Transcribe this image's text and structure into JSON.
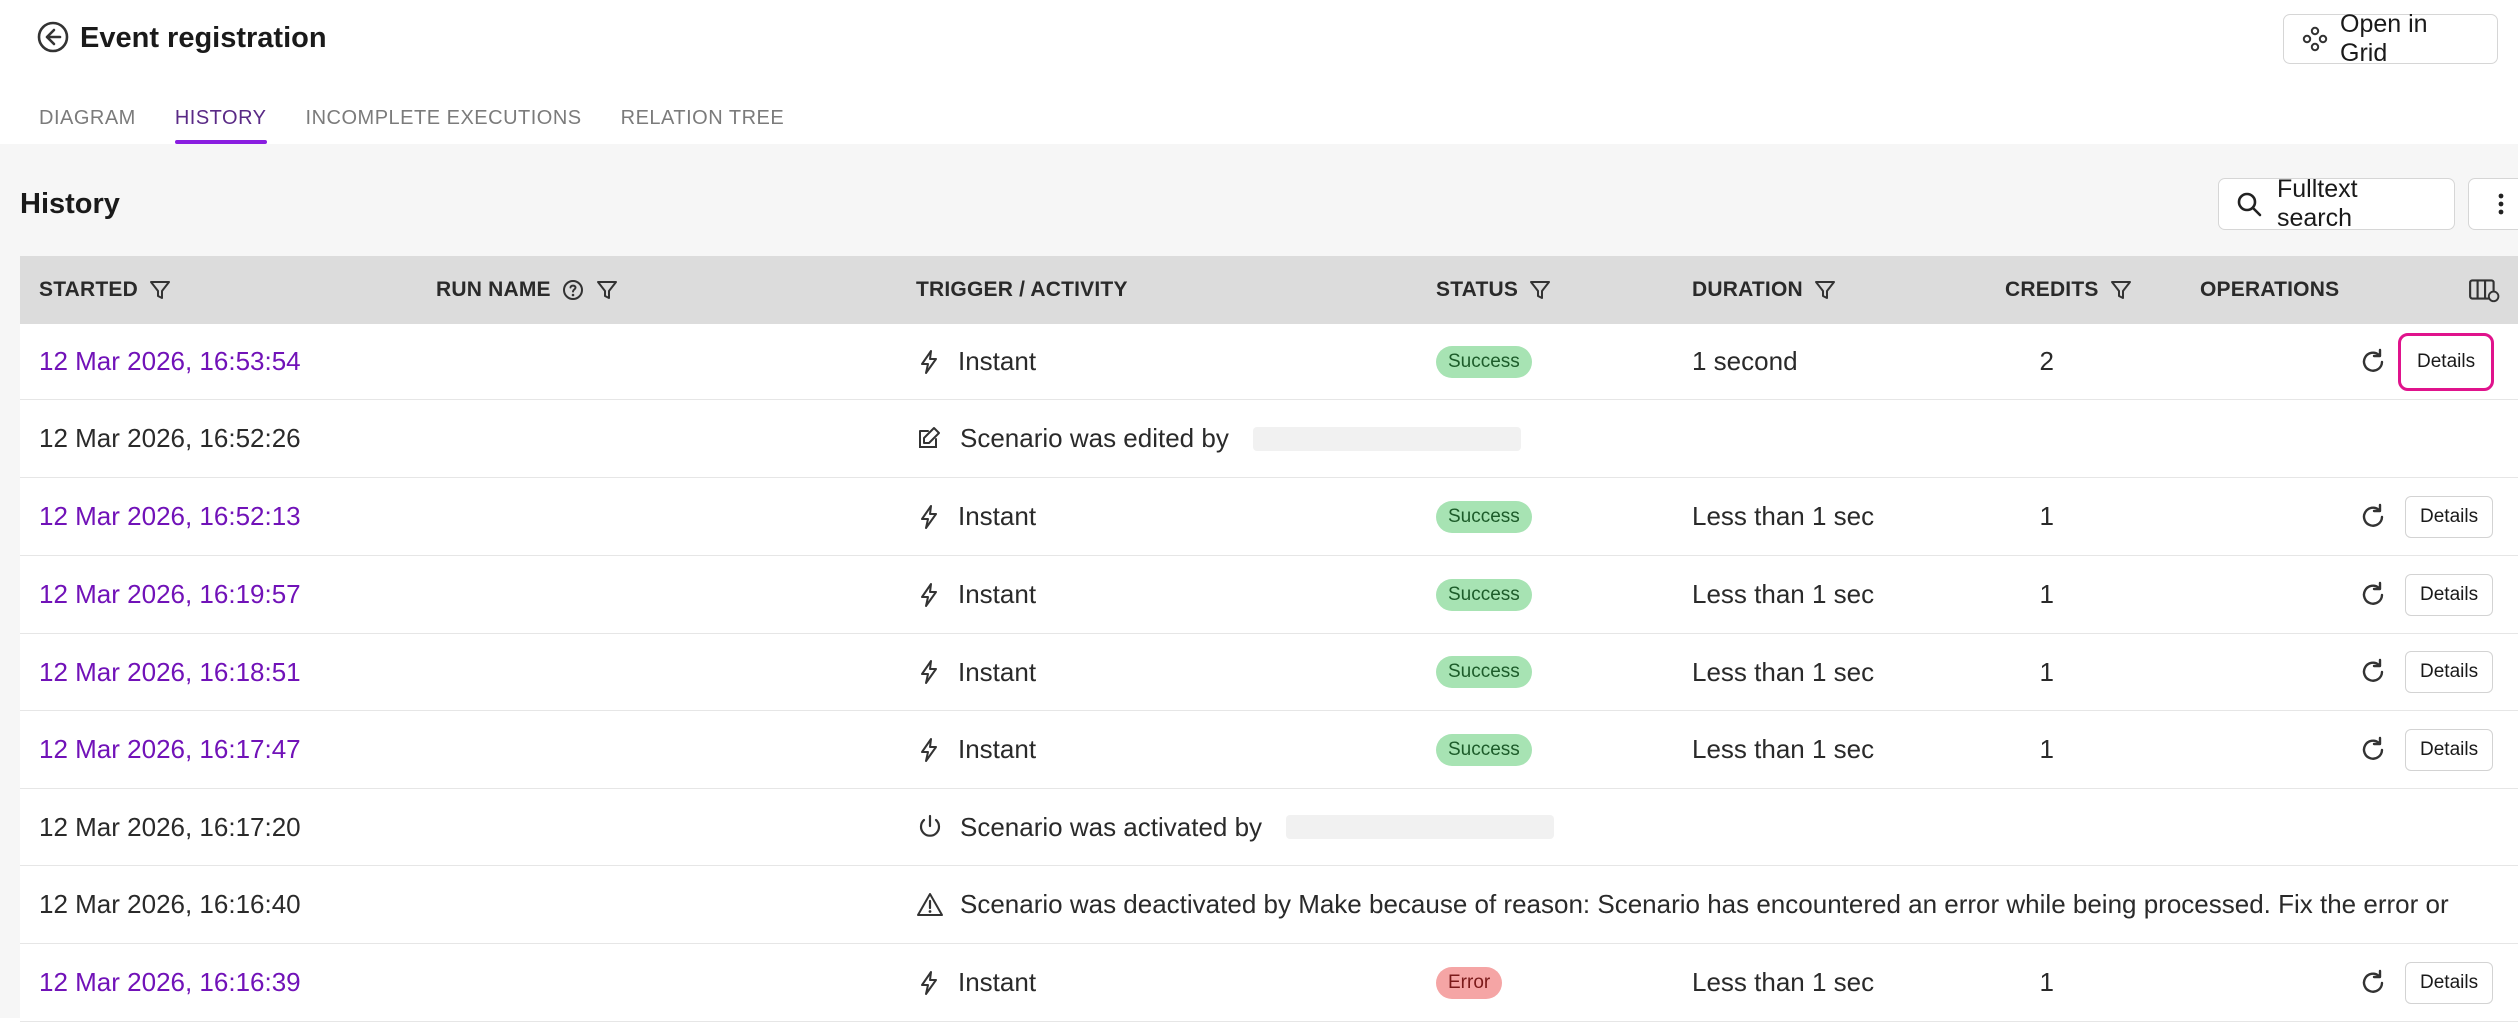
{
  "header": {
    "title": "Event registration",
    "open_grid_label": "Open in Grid",
    "tabs": [
      {
        "label": "DIAGRAM",
        "active": false
      },
      {
        "label": "HISTORY",
        "active": true
      },
      {
        "label": "INCOMPLETE EXECUTIONS",
        "active": false
      },
      {
        "label": "RELATION TREE",
        "active": false
      }
    ]
  },
  "history": {
    "title": "History",
    "search_label": "Fulltext search"
  },
  "table": {
    "columns": {
      "started": "STARTED",
      "run_name": "RUN NAME",
      "trigger": "TRIGGER / ACTIVITY",
      "status": "STATUS",
      "duration": "DURATION",
      "credits": "CREDITS",
      "operations": "OPERATIONS"
    },
    "details_label": "Details",
    "rows": [
      {
        "type": "run",
        "started": "12 Mar 2026, 16:53:54",
        "trigger": "Instant",
        "status": "Success",
        "duration": "1 second",
        "credits": "2",
        "highlighted": true
      },
      {
        "type": "event",
        "icon": "edit-icon",
        "started": "12 Mar 2026, 16:52:26",
        "text": "Scenario was edited by",
        "redacted": true
      },
      {
        "type": "run",
        "started": "12 Mar 2026, 16:52:13",
        "trigger": "Instant",
        "status": "Success",
        "duration": "Less than 1 sec",
        "credits": "1"
      },
      {
        "type": "run",
        "started": "12 Mar 2026, 16:19:57",
        "trigger": "Instant",
        "status": "Success",
        "duration": "Less than 1 sec",
        "credits": "1"
      },
      {
        "type": "run",
        "started": "12 Mar 2026, 16:18:51",
        "trigger": "Instant",
        "status": "Success",
        "duration": "Less than 1 sec",
        "credits": "1"
      },
      {
        "type": "run",
        "started": "12 Mar 2026, 16:17:47",
        "trigger": "Instant",
        "status": "Success",
        "duration": "Less than 1 sec",
        "credits": "1"
      },
      {
        "type": "event",
        "icon": "power-icon",
        "started": "12 Mar 2026, 16:17:20",
        "text": "Scenario was activated by",
        "redacted": true
      },
      {
        "type": "event",
        "icon": "warning-icon",
        "started": "12 Mar 2026, 16:16:40",
        "text": "Scenario was deactivated by Make because of reason: Scenario has encountered an error while being processed. Fix the error or",
        "redacted": false
      },
      {
        "type": "run",
        "started": "12 Mar 2026, 16:16:39",
        "trigger": "Instant",
        "status": "Error",
        "duration": "Less than 1 sec",
        "credits": "1"
      }
    ]
  },
  "colors": {
    "link": "#7112b8",
    "tab_accent": "#8a1ee0",
    "success_bg": "#a7e3b3",
    "error_bg": "#f5a5a5",
    "highlight": "#e0138c"
  }
}
